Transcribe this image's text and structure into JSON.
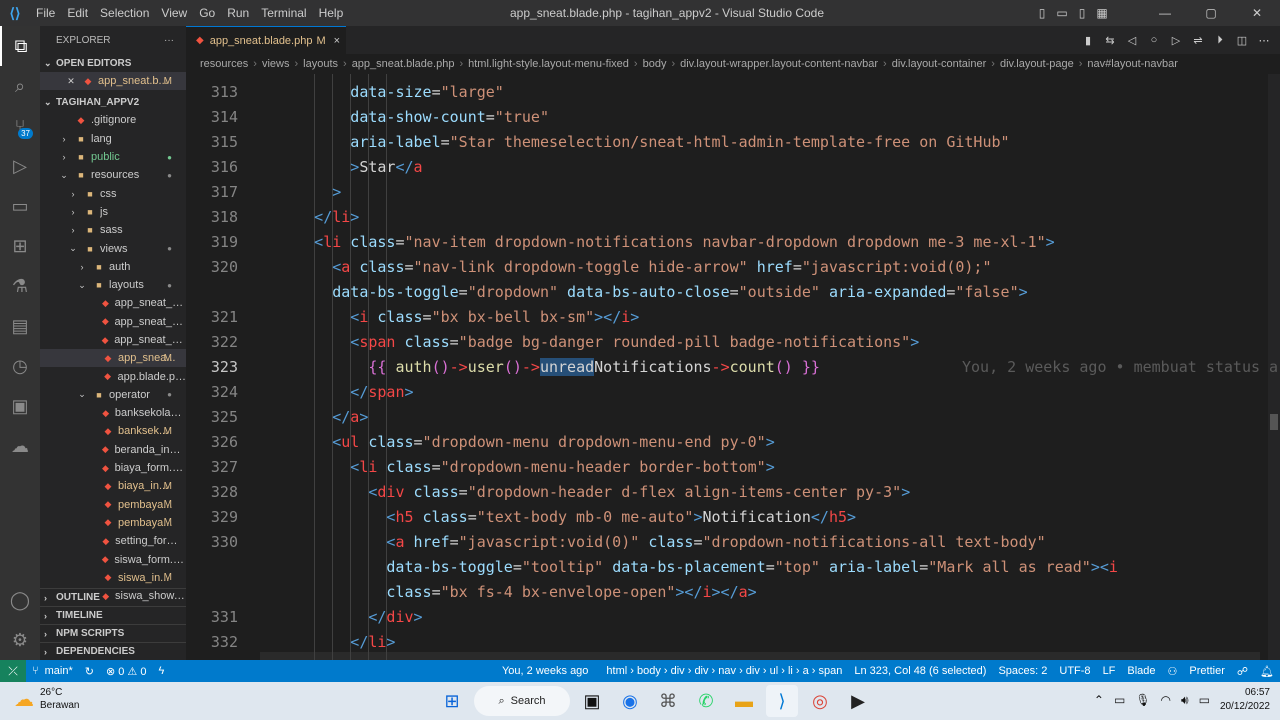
{
  "titlebar": {
    "menu": [
      "File",
      "Edit",
      "Selection",
      "View",
      "Go",
      "Run",
      "Terminal",
      "Help"
    ],
    "title": "app_sneat.blade.php - tagihan_appv2 - Visual Studio Code"
  },
  "activity_bar": {
    "source_control_badge": "37"
  },
  "explorer": {
    "header": "EXPLORER",
    "more": "···",
    "open_editors_label": "OPEN EDITORS",
    "open_editor_file": "app_sneat.b...",
    "open_editor_status": "M",
    "project_label": "TAGIHAN_APPV2",
    "tree": [
      {
        "label": ".gitignore",
        "depth": 1,
        "kind": "file",
        "status": ""
      },
      {
        "label": "lang",
        "depth": 1,
        "kind": "folder",
        "status": ""
      },
      {
        "label": "public",
        "depth": 1,
        "kind": "folder",
        "status": "dot"
      },
      {
        "label": "resources",
        "depth": 1,
        "kind": "folder-open",
        "status": "dot-grey"
      },
      {
        "label": "css",
        "depth": 2,
        "kind": "folder",
        "status": ""
      },
      {
        "label": "js",
        "depth": 2,
        "kind": "folder",
        "status": ""
      },
      {
        "label": "sass",
        "depth": 2,
        "kind": "folder",
        "status": ""
      },
      {
        "label": "views",
        "depth": 2,
        "kind": "folder-open",
        "status": "dot-grey"
      },
      {
        "label": "auth",
        "depth": 3,
        "kind": "folder",
        "status": ""
      },
      {
        "label": "layouts",
        "depth": 3,
        "kind": "folder-open",
        "status": "dot-grey"
      },
      {
        "label": "app_sneat_bla...",
        "depth": 4,
        "kind": "blade",
        "status": ""
      },
      {
        "label": "app_sneat_pdf...",
        "depth": 4,
        "kind": "blade",
        "status": ""
      },
      {
        "label": "app_sneat_wal...",
        "depth": 4,
        "kind": "blade",
        "status": ""
      },
      {
        "label": "app_snea...",
        "depth": 4,
        "kind": "blade",
        "status": "M",
        "selected": true
      },
      {
        "label": "app.blade.php",
        "depth": 4,
        "kind": "blade",
        "status": ""
      },
      {
        "label": "operator",
        "depth": 3,
        "kind": "folder-open",
        "status": "dot-grey"
      },
      {
        "label": "banksekolah_f...",
        "depth": 4,
        "kind": "blade",
        "status": ""
      },
      {
        "label": "banksek...",
        "depth": 4,
        "kind": "blade",
        "status": "M"
      },
      {
        "label": "beranda_index...",
        "depth": 4,
        "kind": "blade",
        "status": ""
      },
      {
        "label": "biaya_form.bla...",
        "depth": 4,
        "kind": "blade",
        "status": ""
      },
      {
        "label": "biaya_in...",
        "depth": 4,
        "kind": "blade",
        "status": "M"
      },
      {
        "label": "pembaya...",
        "depth": 4,
        "kind": "blade",
        "status": "M"
      },
      {
        "label": "pembaya...",
        "depth": 4,
        "kind": "blade",
        "status": "M"
      },
      {
        "label": "setting_form.b...",
        "depth": 4,
        "kind": "blade",
        "status": ""
      },
      {
        "label": "siswa_form.bla...",
        "depth": 4,
        "kind": "blade",
        "status": ""
      },
      {
        "label": "siswa_in...",
        "depth": 4,
        "kind": "blade",
        "status": "M"
      },
      {
        "label": "siswa_show.bl...",
        "depth": 4,
        "kind": "blade",
        "status": ""
      }
    ],
    "bottom_sections": [
      "OUTLINE",
      "TIMELINE",
      "NPM SCRIPTS",
      "DEPENDENCIES"
    ]
  },
  "tab": {
    "label": "app_sneat.blade.php",
    "status": "M",
    "close": "×"
  },
  "breadcrumbs": [
    "resources",
    "views",
    "layouts",
    "app_sneat.blade.php",
    "html.light-style.layout-menu-fixed",
    "body",
    "div.layout-wrapper.layout-content-navbar",
    "div.layout-container",
    "div.layout-page",
    "nav#layout-navbar"
  ],
  "editor": {
    "blame_text": "You, 2 weeks ago • membuat status a",
    "lines": [
      {
        "num": "313",
        "indent": 10,
        "tokens": [
          [
            "attr",
            "data-size"
          ],
          [
            "op",
            "="
          ],
          [
            "str",
            "\"large\""
          ]
        ]
      },
      {
        "num": "314",
        "indent": 10,
        "tokens": [
          [
            "attr",
            "data-show-count"
          ],
          [
            "op",
            "="
          ],
          [
            "str",
            "\"true\""
          ]
        ]
      },
      {
        "num": "315",
        "indent": 10,
        "tokens": [
          [
            "attr",
            "aria-label"
          ],
          [
            "op",
            "="
          ],
          [
            "str",
            "\"Star themeselection/sneat-html-admin-template-free on GitHub\""
          ]
        ]
      },
      {
        "num": "316",
        "indent": 10,
        "tokens": [
          [
            "tag",
            ">"
          ],
          [
            "txt",
            "Star"
          ],
          [
            "tag",
            "</"
          ],
          [
            "tagname",
            "a"
          ]
        ]
      },
      {
        "num": "317",
        "indent": 8,
        "tokens": [
          [
            "tag",
            ">"
          ]
        ]
      },
      {
        "num": "318",
        "indent": 6,
        "tokens": [
          [
            "tag",
            "</"
          ],
          [
            "tagname",
            "li"
          ],
          [
            "tag",
            ">"
          ]
        ]
      },
      {
        "num": "319",
        "indent": 6,
        "tokens": [
          [
            "tag",
            "<"
          ],
          [
            "tagname",
            "li"
          ],
          [
            "txt",
            " "
          ],
          [
            "attr",
            "class"
          ],
          [
            "op",
            "="
          ],
          [
            "str",
            "\"nav-item dropdown-notifications navbar-dropdown dropdown me-3 me-xl-1\""
          ],
          [
            "tag",
            ">"
          ]
        ]
      },
      {
        "num": "320",
        "indent": 8,
        "tokens": [
          [
            "tag",
            "<"
          ],
          [
            "tagname",
            "a"
          ],
          [
            "txt",
            " "
          ],
          [
            "attr",
            "class"
          ],
          [
            "op",
            "="
          ],
          [
            "str",
            "\"nav-link dropdown-toggle hide-arrow\""
          ],
          [
            "txt",
            " "
          ],
          [
            "attr",
            "href"
          ],
          [
            "op",
            "="
          ],
          [
            "str",
            "\"javascript:void(0);\""
          ]
        ]
      },
      {
        "num": "",
        "indent": 8,
        "tokens": [
          [
            "attr",
            "data-bs-toggle"
          ],
          [
            "op",
            "="
          ],
          [
            "str",
            "\"dropdown\""
          ],
          [
            "txt",
            " "
          ],
          [
            "attr",
            "data-bs-auto-close"
          ],
          [
            "op",
            "="
          ],
          [
            "str",
            "\"outside\""
          ],
          [
            "txt",
            " "
          ],
          [
            "attr",
            "aria-expanded"
          ],
          [
            "op",
            "="
          ],
          [
            "str",
            "\"false\""
          ],
          [
            "tag",
            ">"
          ]
        ]
      },
      {
        "num": "321",
        "indent": 10,
        "tokens": [
          [
            "tag",
            "<"
          ],
          [
            "tagname",
            "i"
          ],
          [
            "txt",
            " "
          ],
          [
            "attr",
            "class"
          ],
          [
            "op",
            "="
          ],
          [
            "str",
            "\"bx bx-bell bx-sm\""
          ],
          [
            "tag",
            "></"
          ],
          [
            "tagname",
            "i"
          ],
          [
            "tag",
            ">"
          ]
        ]
      },
      {
        "num": "322",
        "indent": 10,
        "tokens": [
          [
            "tag",
            "<"
          ],
          [
            "tagname",
            "span"
          ],
          [
            "txt",
            " "
          ],
          [
            "attr",
            "class"
          ],
          [
            "op",
            "="
          ],
          [
            "str",
            "\"badge bg-danger rounded-pill badge-notifications\""
          ],
          [
            "tag",
            ">"
          ]
        ]
      },
      {
        "num": "323",
        "indent": 12,
        "current": true,
        "tokens": [
          [
            "br",
            "{{"
          ],
          [
            "txt",
            " "
          ],
          [
            "fn",
            "auth"
          ],
          [
            "br",
            "()"
          ],
          [
            "tagname",
            "->"
          ],
          [
            "fn",
            "user"
          ],
          [
            "br",
            "()"
          ],
          [
            "tagname",
            "->"
          ],
          [
            "sel",
            "unread"
          ],
          [
            "txt",
            "Notifications"
          ],
          [
            "tagname",
            "->"
          ],
          [
            "fn",
            "count"
          ],
          [
            "br",
            "()"
          ],
          [
            "txt",
            " "
          ],
          [
            "br",
            "}}"
          ]
        ]
      },
      {
        "num": "324",
        "indent": 10,
        "tokens": [
          [
            "tag",
            "</"
          ],
          [
            "tagname",
            "span"
          ],
          [
            "tag",
            ">"
          ]
        ]
      },
      {
        "num": "325",
        "indent": 8,
        "tokens": [
          [
            "tag",
            "</"
          ],
          [
            "tagname",
            "a"
          ],
          [
            "tag",
            ">"
          ]
        ]
      },
      {
        "num": "326",
        "indent": 8,
        "tokens": [
          [
            "tag",
            "<"
          ],
          [
            "tagname",
            "ul"
          ],
          [
            "txt",
            " "
          ],
          [
            "attr",
            "class"
          ],
          [
            "op",
            "="
          ],
          [
            "str",
            "\"dropdown-menu dropdown-menu-end py-0\""
          ],
          [
            "tag",
            ">"
          ]
        ]
      },
      {
        "num": "327",
        "indent": 10,
        "tokens": [
          [
            "tag",
            "<"
          ],
          [
            "tagname",
            "li"
          ],
          [
            "txt",
            " "
          ],
          [
            "attr",
            "class"
          ],
          [
            "op",
            "="
          ],
          [
            "str",
            "\"dropdown-menu-header border-bottom\""
          ],
          [
            "tag",
            ">"
          ]
        ]
      },
      {
        "num": "328",
        "indent": 12,
        "tokens": [
          [
            "tag",
            "<"
          ],
          [
            "tagname",
            "div"
          ],
          [
            "txt",
            " "
          ],
          [
            "attr",
            "class"
          ],
          [
            "op",
            "="
          ],
          [
            "str",
            "\"dropdown-header d-flex align-items-center py-3\""
          ],
          [
            "tag",
            ">"
          ]
        ]
      },
      {
        "num": "329",
        "indent": 14,
        "tokens": [
          [
            "tag",
            "<"
          ],
          [
            "tagname",
            "h5"
          ],
          [
            "txt",
            " "
          ],
          [
            "attr",
            "class"
          ],
          [
            "op",
            "="
          ],
          [
            "str",
            "\"text-body mb-0 me-auto\""
          ],
          [
            "tag",
            ">"
          ],
          [
            "txt",
            "Notification"
          ],
          [
            "tag",
            "</"
          ],
          [
            "tagname",
            "h5"
          ],
          [
            "tag",
            ">"
          ]
        ]
      },
      {
        "num": "330",
        "indent": 14,
        "tokens": [
          [
            "tag",
            "<"
          ],
          [
            "tagname",
            "a"
          ],
          [
            "txt",
            " "
          ],
          [
            "attr",
            "href"
          ],
          [
            "op",
            "="
          ],
          [
            "str",
            "\"javascript:void(0)\""
          ],
          [
            "txt",
            " "
          ],
          [
            "attr",
            "class"
          ],
          [
            "op",
            "="
          ],
          [
            "str",
            "\"dropdown-notifications-all text-body\""
          ]
        ]
      },
      {
        "num": "",
        "indent": 14,
        "tokens": [
          [
            "attr",
            "data-bs-toggle"
          ],
          [
            "op",
            "="
          ],
          [
            "str",
            "\"tooltip\""
          ],
          [
            "txt",
            " "
          ],
          [
            "attr",
            "data-bs-placement"
          ],
          [
            "op",
            "="
          ],
          [
            "str",
            "\"top\""
          ],
          [
            "txt",
            " "
          ],
          [
            "attr",
            "aria-label"
          ],
          [
            "op",
            "="
          ],
          [
            "str",
            "\"Mark all as read\""
          ],
          [
            "tag",
            ">"
          ],
          [
            "tag",
            "<"
          ],
          [
            "tagname",
            "i"
          ]
        ]
      },
      {
        "num": "",
        "indent": 14,
        "tokens": [
          [
            "attr",
            "class"
          ],
          [
            "op",
            "="
          ],
          [
            "str",
            "\"bx fs-4 bx-envelope-open\""
          ],
          [
            "tag",
            "></"
          ],
          [
            "tagname",
            "i"
          ],
          [
            "tag",
            "></"
          ],
          [
            "tagname",
            "a"
          ],
          [
            "tag",
            ">"
          ]
        ]
      },
      {
        "num": "331",
        "indent": 12,
        "tokens": [
          [
            "tag",
            "</"
          ],
          [
            "tagname",
            "div"
          ],
          [
            "tag",
            ">"
          ]
        ]
      },
      {
        "num": "332",
        "indent": 10,
        "tokens": [
          [
            "tag",
            "</"
          ],
          [
            "tagname",
            "li"
          ],
          [
            "tag",
            ">"
          ]
        ]
      }
    ]
  },
  "statusbar": {
    "remote": "⤫",
    "branch": "main*",
    "sync": "↻",
    "problems": "⊗ 0 ⚠ 0",
    "lightning": "ϟ",
    "blame": "You, 2 weeks ago",
    "path": "html › body › div › div › nav › div › ul › li › a › span",
    "position": "Ln 323, Col 48 (6 selected)",
    "spaces": "Spaces: 2",
    "encoding": "UTF-8",
    "eol": "LF",
    "language": "Blade",
    "prettier": "Prettier"
  },
  "taskbar": {
    "temp": "26°C",
    "weather": "Berawan",
    "search_label": "Search",
    "time": "06:57",
    "date": "20/12/2022"
  }
}
